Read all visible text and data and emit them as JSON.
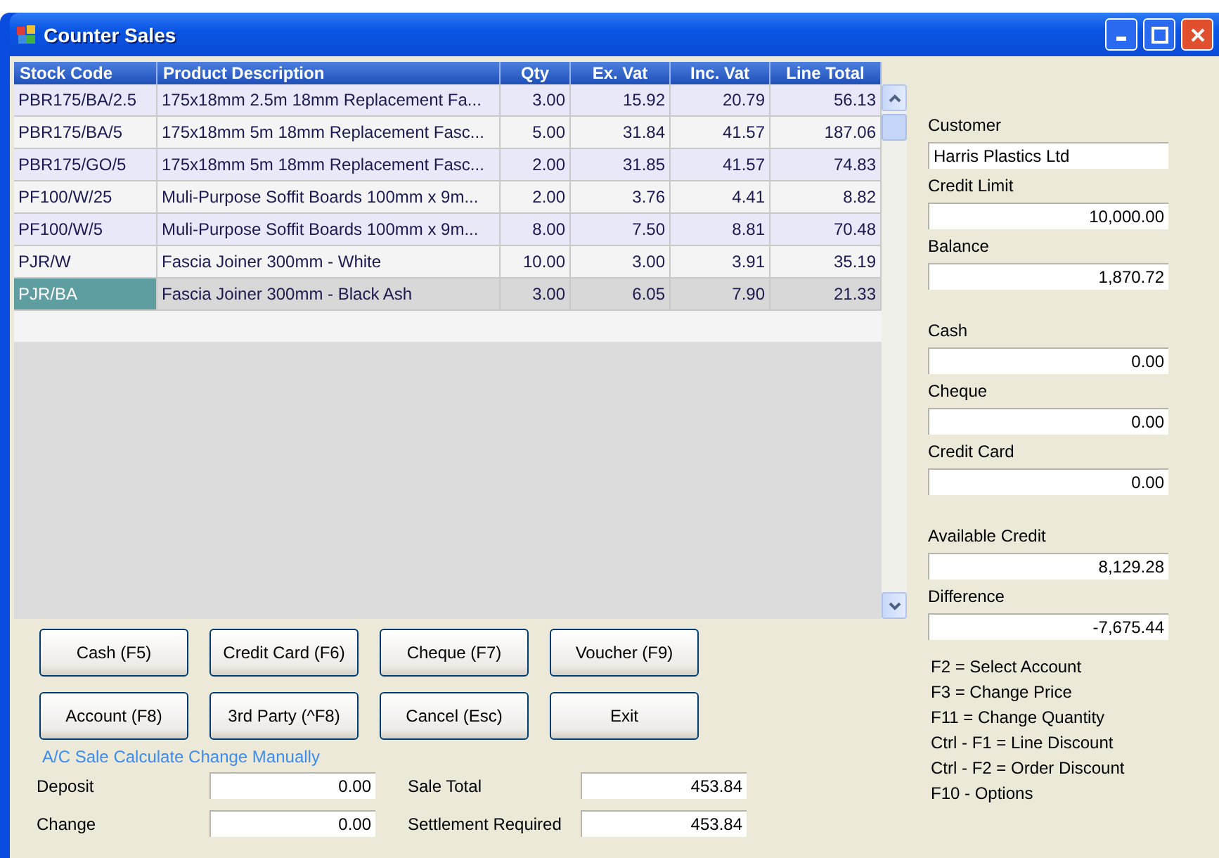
{
  "window": {
    "title": "Counter Sales"
  },
  "table": {
    "columns": [
      "Stock Code",
      "Product Description",
      "Qty",
      "Ex. Vat",
      "Inc. Vat",
      "Line Total"
    ],
    "rows": [
      {
        "cells": [
          "PBR175/BA/2.5",
          "175x18mm 2.5m 18mm Replacement Fa...",
          "3.00",
          "15.92",
          "20.79",
          "56.13"
        ],
        "selected": false
      },
      {
        "cells": [
          "PBR175/BA/5",
          "175x18mm 5m 18mm Replacement Fasc...",
          "5.00",
          "31.84",
          "41.57",
          "187.06"
        ],
        "selected": false
      },
      {
        "cells": [
          "PBR175/GO/5",
          "175x18mm 5m 18mm Replacement Fasc...",
          "2.00",
          "31.85",
          "41.57",
          "74.83"
        ],
        "selected": false
      },
      {
        "cells": [
          "PF100/W/25",
          "Muli-Purpose Soffit Boards 100mm x 9m...",
          "2.00",
          "3.76",
          "4.41",
          "8.82"
        ],
        "selected": false
      },
      {
        "cells": [
          "PF100/W/5",
          "Muli-Purpose Soffit Boards 100mm x 9m...",
          "8.00",
          "7.50",
          "8.81",
          "70.48"
        ],
        "selected": false
      },
      {
        "cells": [
          "PJR/W",
          "Fascia Joiner 300mm - White",
          "10.00",
          "3.00",
          "3.91",
          "35.19"
        ],
        "selected": false
      },
      {
        "cells": [
          "PJR/BA",
          "Fascia Joiner 300mm - Black Ash",
          "3.00",
          "6.05",
          "7.90",
          "21.33"
        ],
        "selected": true
      }
    ]
  },
  "buttons": [
    [
      "Cash (F5)",
      "Credit Card (F6)",
      "Cheque (F7)",
      "Voucher (F9)"
    ],
    [
      "Account (F8)",
      "3rd Party (^F8)",
      "Cancel (Esc)",
      "Exit"
    ]
  ],
  "manual_change_link": "A/C Sale Calculate Change Manually",
  "totals": [
    {
      "label": "Deposit",
      "value": "0.00"
    },
    {
      "label": "Sale Total",
      "value": "453.84"
    },
    {
      "label": "Change",
      "value": "0.00"
    },
    {
      "label": "Settlement Required",
      "value": "453.84"
    }
  ],
  "account_panel": [
    [
      {
        "label": "Customer",
        "value": "Harris Plastics Ltd",
        "kind": "text"
      },
      {
        "label": "Credit Limit",
        "value": "10,000.00",
        "kind": "amount"
      },
      {
        "label": "Balance",
        "value": "1,870.72",
        "kind": "amount"
      }
    ],
    [
      {
        "label": "Cash",
        "value": "0.00",
        "kind": "amount"
      },
      {
        "label": "Cheque",
        "value": "0.00",
        "kind": "amount"
      },
      {
        "label": "Credit Card",
        "value": "0.00",
        "kind": "amount"
      }
    ],
    [
      {
        "label": "Available Credit",
        "value": "8,129.28",
        "kind": "amount"
      },
      {
        "label": "Difference",
        "value": "-7,675.44",
        "kind": "amount"
      }
    ]
  ],
  "shortcuts": [
    "F2 = Select Account",
    "F3 = Change Price",
    "F11 = Change Quantity",
    "Ctrl - F1 = Line Discount",
    "Ctrl - F2 = Order Discount",
    "F10 - Options"
  ]
}
